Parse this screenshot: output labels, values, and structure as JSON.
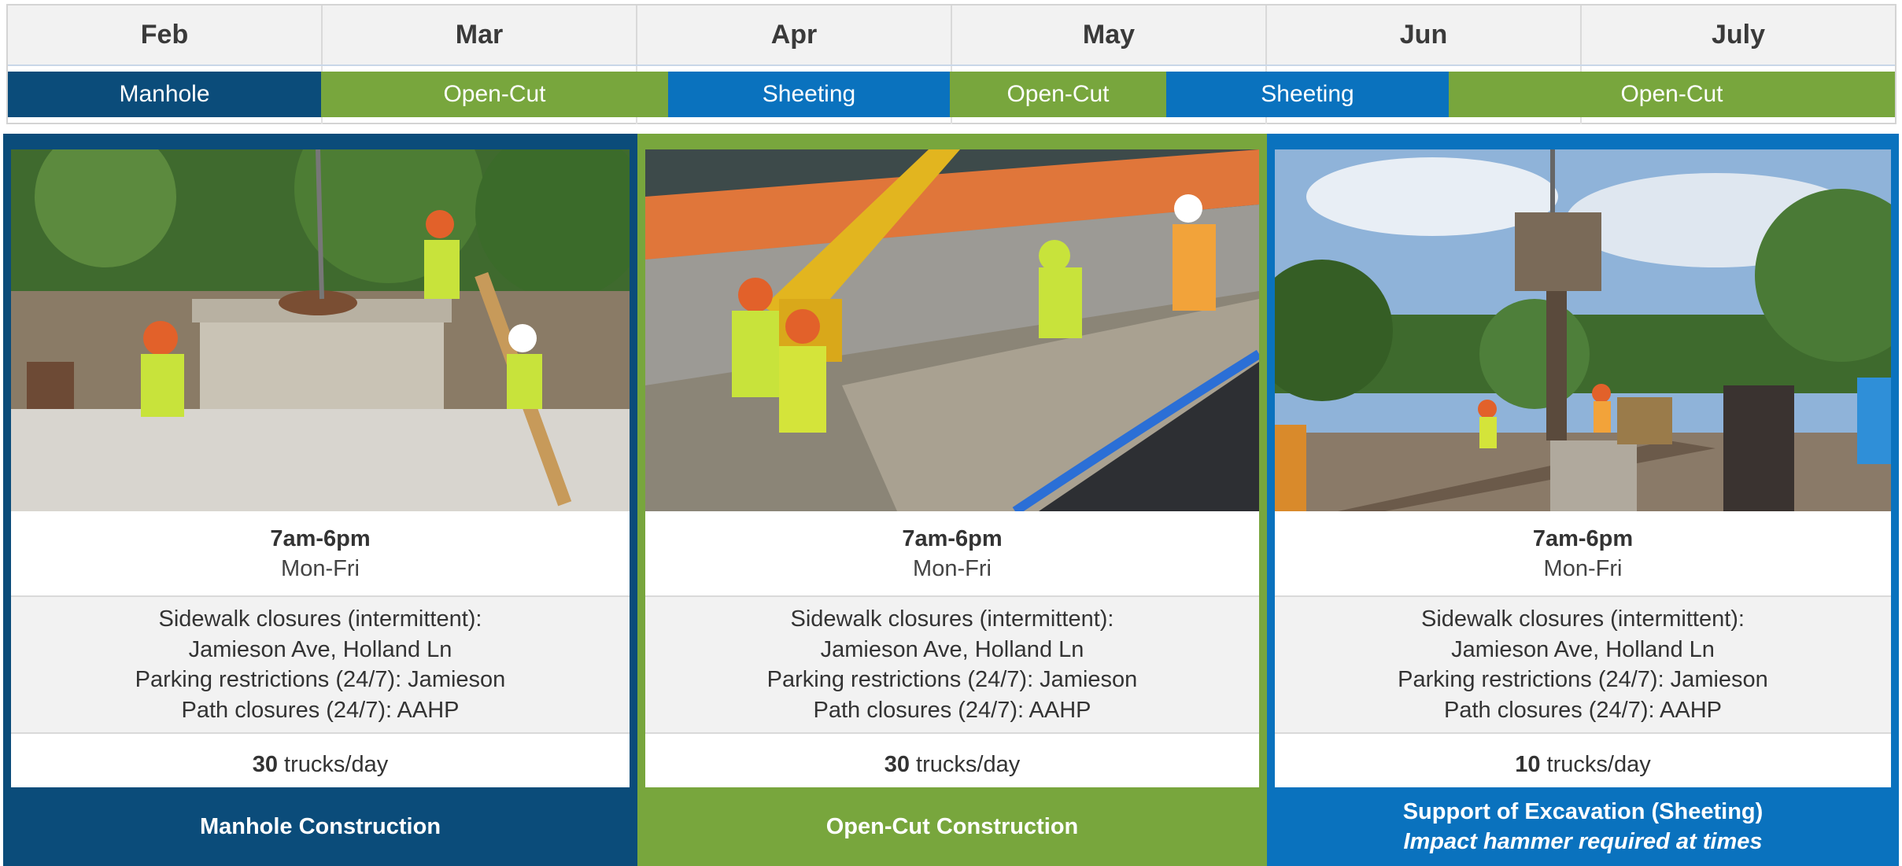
{
  "colors": {
    "navy": "#0b4c7a",
    "green": "#78a63d",
    "blue": "#0a72be",
    "header_bg": "#f2f2f2",
    "row_alt": "#f2f2f2"
  },
  "timeline": {
    "months": [
      "Feb",
      "Mar",
      "Apr",
      "May",
      "Jun",
      "July"
    ],
    "phases": [
      {
        "label": "Manhole",
        "color": "navy"
      },
      {
        "label": "Open-Cut",
        "color": "green"
      },
      {
        "label": "Sheeting",
        "color": "blue"
      },
      {
        "label": "Open-Cut",
        "color": "green"
      },
      {
        "label": "Sheeting",
        "color": "blue"
      },
      {
        "label": "Open-Cut",
        "color": "green"
      }
    ]
  },
  "cards": [
    {
      "photo": "manhole-construction-photo",
      "time": "7am-6pm",
      "days": "Mon-Fri",
      "closures": [
        "Sidewalk closures (intermittent):",
        "Jamieson Ave, Holland Ln",
        "Parking restrictions (24/7): Jamieson",
        "Path closures (24/7): AAHP"
      ],
      "trucks_count": "30",
      "trucks_unit": "trucks/day",
      "title": "Manhole Construction",
      "subtitle": ""
    },
    {
      "photo": "open-cut-construction-photo",
      "time": "7am-6pm",
      "days": "Mon-Fri",
      "closures": [
        "Sidewalk closures (intermittent):",
        "Jamieson Ave, Holland Ln",
        "Parking restrictions (24/7): Jamieson",
        "Path closures (24/7): AAHP"
      ],
      "trucks_count": "30",
      "trucks_unit": "trucks/day",
      "title": "Open-Cut Construction",
      "subtitle": ""
    },
    {
      "photo": "sheeting-excavation-photo",
      "time": "7am-6pm",
      "days": "Mon-Fri",
      "closures": [
        "Sidewalk closures (intermittent):",
        "Jamieson Ave, Holland Ln",
        "Parking restrictions (24/7): Jamieson",
        "Path closures (24/7): AAHP"
      ],
      "trucks_count": "10",
      "trucks_unit": "trucks/day",
      "title": "Support of Excavation (Sheeting)",
      "subtitle": "Impact hammer required at times"
    }
  ]
}
